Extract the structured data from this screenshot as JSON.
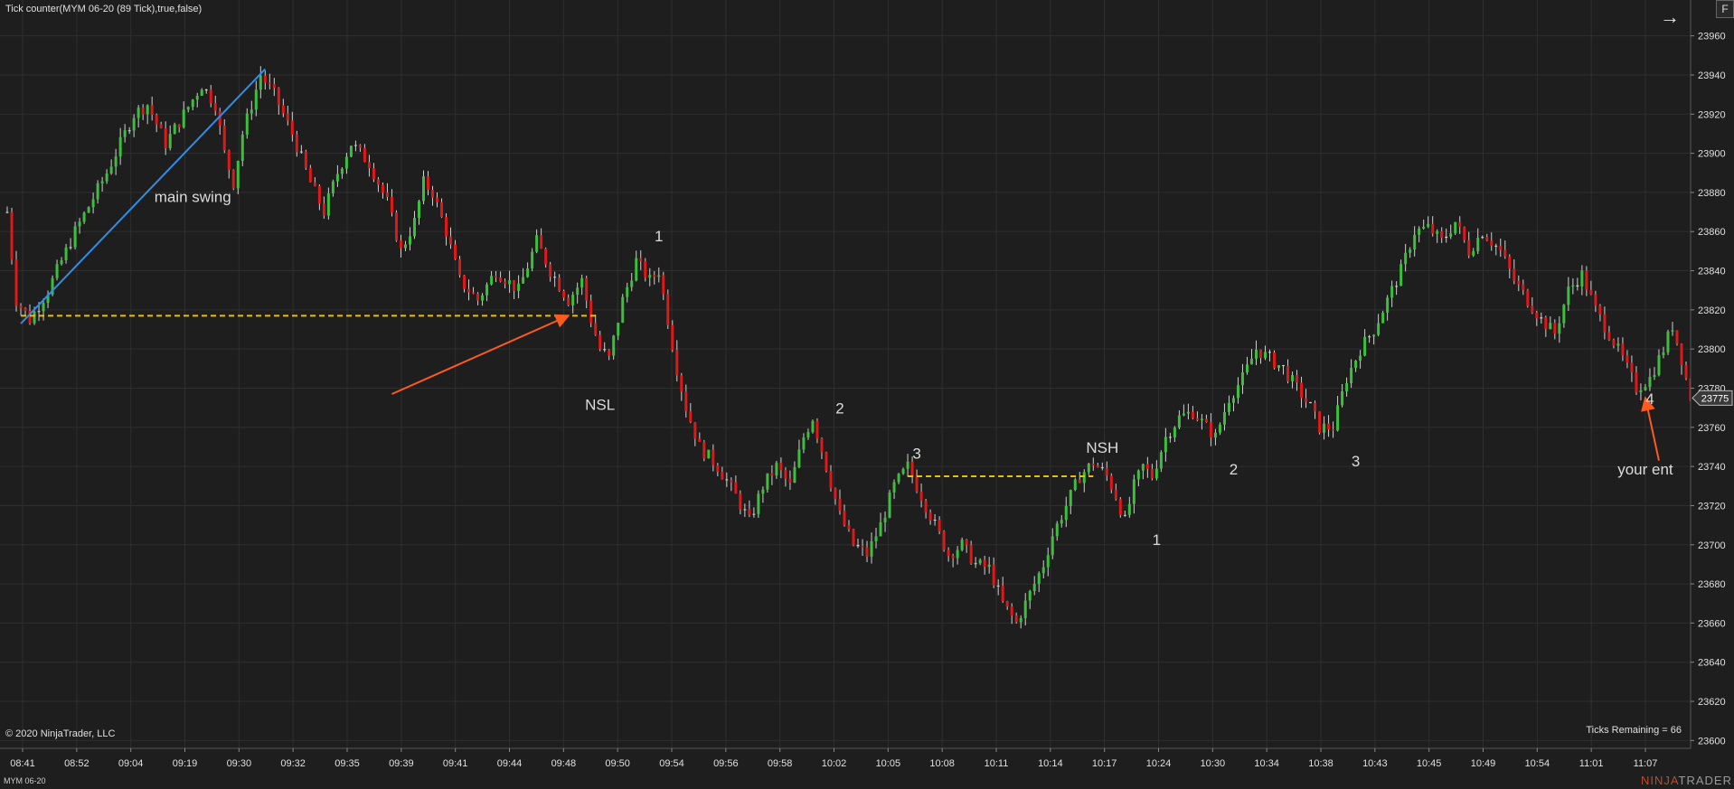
{
  "header": {
    "indicator_label": "Tick counter(MYM 06-20 (89 Tick),true,false)",
    "nav_arrow": "→",
    "f_button": "F"
  },
  "footer": {
    "copyright": "© 2020 NinjaTrader, LLC",
    "ticks_remaining": "Ticks Remaining = 66",
    "instrument": "MYM 06-20",
    "logo_ninja": "NINJA",
    "logo_trader": "TRADER"
  },
  "colors": {
    "background": "#1e1e1e",
    "grid": "#2f2f2f",
    "up": "#3cbf3c",
    "down": "#e01818",
    "doji": "#d0d0d0",
    "trendline": "#2f8fe8",
    "arrow": "#ff5a1e",
    "level": "#f0c000",
    "text": "#e0e0e0"
  },
  "chart_data": {
    "type": "candlestick",
    "instrument": "MYM 06-20",
    "bar_type": "89 Tick",
    "ylim": [
      23650,
      23970
    ],
    "y_ticks": [
      23600,
      23620,
      23640,
      23660,
      23680,
      23700,
      23720,
      23740,
      23760,
      23780,
      23800,
      23820,
      23840,
      23860,
      23880,
      23900,
      23920,
      23940,
      23960
    ],
    "x_ticks": [
      "08:41",
      "08:52",
      "09:04",
      "09:19",
      "09:30",
      "09:32",
      "09:35",
      "09:39",
      "09:41",
      "09:44",
      "09:48",
      "09:50",
      "09:54",
      "09:56",
      "09:58",
      "10:02",
      "10:05",
      "10:08",
      "10:11",
      "10:14",
      "10:17",
      "10:24",
      "10:30",
      "10:34",
      "10:38",
      "10:43",
      "10:45",
      "10:49",
      "10:54",
      "11:01",
      "11:07"
    ],
    "last_price": "23775",
    "price_path": [
      [
        0,
        23870
      ],
      [
        2,
        23825
      ],
      [
        5,
        23815
      ],
      [
        9,
        23830
      ],
      [
        15,
        23860
      ],
      [
        22,
        23890
      ],
      [
        28,
        23920
      ],
      [
        31,
        23925
      ],
      [
        35,
        23905
      ],
      [
        39,
        23920
      ],
      [
        43,
        23935
      ],
      [
        46,
        23925
      ],
      [
        48,
        23900
      ],
      [
        50,
        23885
      ],
      [
        52,
        23910
      ],
      [
        56,
        23940
      ],
      [
        59,
        23930
      ],
      [
        63,
        23910
      ],
      [
        67,
        23885
      ],
      [
        70,
        23870
      ],
      [
        73,
        23890
      ],
      [
        76,
        23905
      ],
      [
        80,
        23895
      ],
      [
        84,
        23875
      ],
      [
        87,
        23850
      ],
      [
        90,
        23865
      ],
      [
        92,
        23885
      ],
      [
        94,
        23880
      ],
      [
        97,
        23860
      ],
      [
        100,
        23835
      ],
      [
        104,
        23825
      ],
      [
        108,
        23840
      ],
      [
        113,
        23830
      ],
      [
        117,
        23855
      ],
      [
        120,
        23840
      ],
      [
        124,
        23825
      ],
      [
        127,
        23835
      ],
      [
        129,
        23815
      ],
      [
        131,
        23800
      ],
      [
        133,
        23795
      ],
      [
        136,
        23825
      ],
      [
        139,
        23845
      ],
      [
        142,
        23835
      ],
      [
        144,
        23840
      ],
      [
        146,
        23815
      ],
      [
        148,
        23790
      ],
      [
        150,
        23770
      ],
      [
        153,
        23750
      ],
      [
        157,
        23740
      ],
      [
        161,
        23725
      ],
      [
        164,
        23712
      ],
      [
        167,
        23730
      ],
      [
        170,
        23740
      ],
      [
        173,
        23730
      ],
      [
        176,
        23755
      ],
      [
        178,
        23765
      ],
      [
        181,
        23740
      ],
      [
        184,
        23715
      ],
      [
        187,
        23700
      ],
      [
        190,
        23695
      ],
      [
        193,
        23710
      ],
      [
        196,
        23730
      ],
      [
        199,
        23740
      ],
      [
        202,
        23725
      ],
      [
        205,
        23710
      ],
      [
        208,
        23695
      ],
      [
        211,
        23700
      ],
      [
        214,
        23690
      ],
      [
        217,
        23688
      ],
      [
        220,
        23670
      ],
      [
        223,
        23660
      ],
      [
        226,
        23675
      ],
      [
        229,
        23690
      ],
      [
        231,
        23705
      ],
      [
        234,
        23720
      ],
      [
        237,
        23735
      ],
      [
        240,
        23742
      ],
      [
        243,
        23735
      ],
      [
        245,
        23725
      ],
      [
        247,
        23712
      ],
      [
        249,
        23730
      ],
      [
        251,
        23740
      ],
      [
        253,
        23735
      ],
      [
        256,
        23755
      ],
      [
        259,
        23765
      ],
      [
        262,
        23768
      ],
      [
        265,
        23760
      ],
      [
        267,
        23755
      ],
      [
        270,
        23775
      ],
      [
        273,
        23785
      ],
      [
        276,
        23800
      ],
      [
        279,
        23795
      ],
      [
        282,
        23790
      ],
      [
        285,
        23780
      ],
      [
        288,
        23770
      ],
      [
        290,
        23760
      ],
      [
        293,
        23760
      ],
      [
        296,
        23785
      ],
      [
        299,
        23800
      ],
      [
        302,
        23810
      ],
      [
        305,
        23825
      ],
      [
        308,
        23840
      ],
      [
        311,
        23860
      ],
      [
        314,
        23862
      ],
      [
        317,
        23855
      ],
      [
        320,
        23865
      ],
      [
        323,
        23850
      ],
      [
        326,
        23860
      ],
      [
        330,
        23850
      ],
      [
        333,
        23835
      ],
      [
        336,
        23825
      ],
      [
        339,
        23815
      ],
      [
        342,
        23808
      ],
      [
        345,
        23830
      ],
      [
        348,
        23838
      ],
      [
        351,
        23820
      ],
      [
        354,
        23808
      ],
      [
        357,
        23795
      ],
      [
        360,
        23780
      ],
      [
        363,
        23785
      ],
      [
        366,
        23800
      ],
      [
        368,
        23812
      ],
      [
        370,
        23795
      ],
      [
        372,
        23775
      ]
    ],
    "annotations": [
      {
        "type": "trendline",
        "label": "main swing",
        "from": [
          3,
          23813
        ],
        "to": [
          57,
          23943
        ]
      },
      {
        "type": "horizontal_level",
        "price": 23817,
        "from": 3,
        "to": 130
      },
      {
        "type": "horizontal_level",
        "price": 23735,
        "from": 199,
        "to": 240
      },
      {
        "type": "arrow",
        "from": [
          85,
          23777
        ],
        "to": [
          124,
          23817
        ]
      },
      {
        "type": "arrow",
        "from": [
          365,
          23743
        ],
        "to": [
          362,
          23775
        ]
      }
    ],
    "labels": [
      {
        "text": "main swing",
        "x": 41,
        "y": 23875
      },
      {
        "text": "1",
        "x": 144,
        "y": 23855
      },
      {
        "text": "NSL",
        "x": 131,
        "y": 23769
      },
      {
        "text": "2",
        "x": 184,
        "y": 23767
      },
      {
        "text": "3",
        "x": 201,
        "y": 23744
      },
      {
        "text": "NSH",
        "x": 242,
        "y": 23747
      },
      {
        "text": "1",
        "x": 254,
        "y": 23700
      },
      {
        "text": "2",
        "x": 271,
        "y": 23736
      },
      {
        "text": "3",
        "x": 298,
        "y": 23740
      },
      {
        "text": "4",
        "x": 363,
        "y": 23772
      },
      {
        "text": "your ent",
        "x": 362,
        "y": 23736
      }
    ]
  }
}
